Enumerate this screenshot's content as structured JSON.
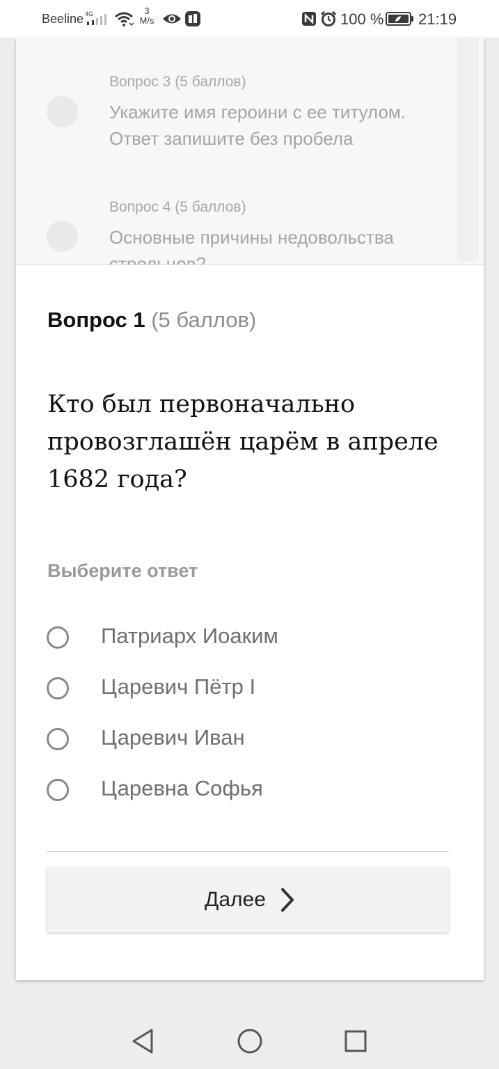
{
  "status_bar": {
    "carrier": "Beeline",
    "network": "4G",
    "speed_value": "3",
    "speed_unit": "M/s",
    "battery_percent": "100 %",
    "time": "21:19",
    "icons": [
      "signal-icon",
      "wifi-icon",
      "eye-icon",
      "app-notification-icon",
      "nfc-icon",
      "alarm-icon",
      "battery-icon"
    ]
  },
  "question_list": {
    "items": [
      {
        "header": "Вопрос 3 (5 баллов)",
        "text": "Укажите имя героини с ее титулом. Ответ запишите без пробела"
      },
      {
        "header": "Вопрос 4 (5 баллов)",
        "text": "Основные причины недовольства стрельцов?"
      }
    ]
  },
  "current_question": {
    "number_label": "Вопрос 1",
    "points_label": "(5 баллов)",
    "text": "Кто был первоначально провозглашён царём в апреле 1682 года?",
    "choose_label": "Выберите ответ",
    "options": [
      "Патриарх Иоаким",
      "Царевич Пётр I",
      "Царевич Иван",
      "Царевна Софья"
    ]
  },
  "actions": {
    "next_label": "Далее"
  },
  "navigation": {
    "icons": [
      "back-icon",
      "home-icon",
      "recents-icon"
    ]
  }
}
